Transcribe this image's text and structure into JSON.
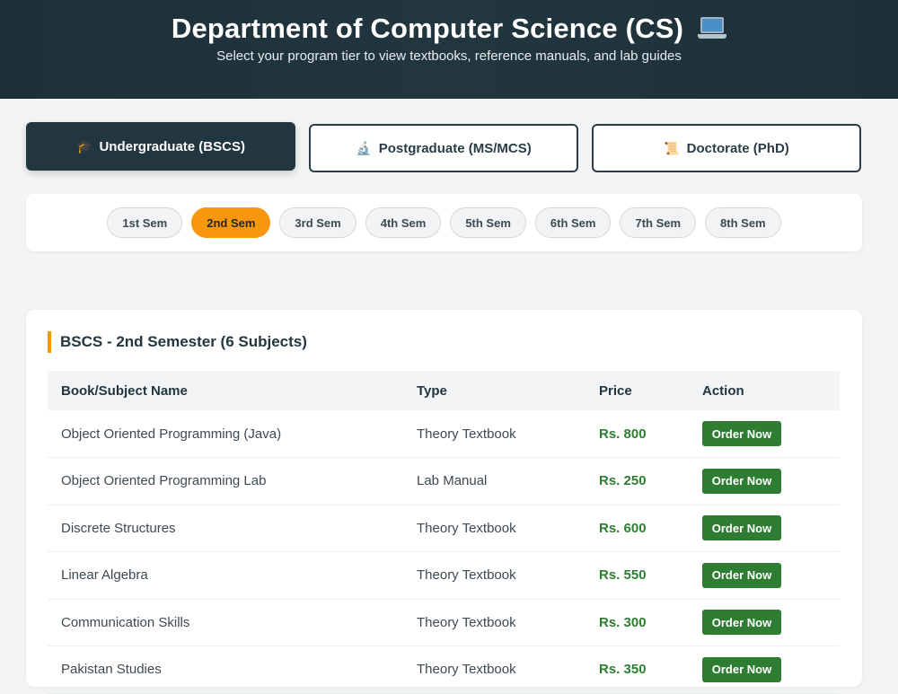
{
  "header": {
    "title": "Department of Computer Science (CS)",
    "subtitle": "Select your program tier to view textbooks, reference manuals, and lab guides"
  },
  "tiers": [
    {
      "icon": "🎓",
      "label": "Undergraduate (BSCS)",
      "active": true
    },
    {
      "icon": "🔬",
      "label": "Postgraduate (MS/MCS)",
      "active": false
    },
    {
      "icon": "📜",
      "label": "Doctorate (PhD)",
      "active": false
    }
  ],
  "semesters": [
    "1st Sem",
    "2nd Sem",
    "3rd Sem",
    "4th Sem",
    "5th Sem",
    "6th Sem",
    "7th Sem",
    "8th Sem"
  ],
  "active_semester": "2nd Sem",
  "section": {
    "title": "BSCS - 2nd Semester (6 Subjects)",
    "columns": [
      "Book/Subject Name",
      "Type",
      "Price",
      "Action"
    ],
    "rows": [
      {
        "name": "Object Oriented Programming (Java)",
        "type": "Theory Textbook",
        "price": "Rs. 800",
        "action": "Order Now"
      },
      {
        "name": "Object Oriented Programming Lab",
        "type": "Lab Manual",
        "price": "Rs. 250",
        "action": "Order Now"
      },
      {
        "name": "Discrete Structures",
        "type": "Theory Textbook",
        "price": "Rs. 600",
        "action": "Order Now"
      },
      {
        "name": "Linear Algebra",
        "type": "Theory Textbook",
        "price": "Rs. 550",
        "action": "Order Now"
      },
      {
        "name": "Communication Skills",
        "type": "Theory Textbook",
        "price": "Rs. 300",
        "action": "Order Now"
      },
      {
        "name": "Pakistan Studies",
        "type": "Theory Textbook",
        "price": "Rs. 350",
        "action": "Order Now"
      }
    ]
  },
  "colors": {
    "header_bg": "#1d3039",
    "accent_orange": "#f7960f",
    "price_green": "#2e7d32",
    "order_button": "#2e7d32"
  }
}
